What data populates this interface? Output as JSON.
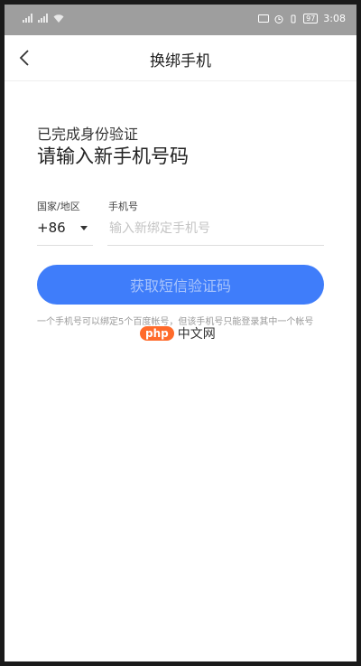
{
  "status_bar": {
    "time": "3:08",
    "battery": "97"
  },
  "header": {
    "title": "换绑手机"
  },
  "main": {
    "verified_text": "已完成身份验证",
    "prompt_text": "请输入新手机号码",
    "country_label": "国家/地区",
    "country_code": "+86",
    "phone_label": "手机号",
    "phone_placeholder": "输入新绑定手机号",
    "phone_value": "",
    "submit_label": "获取短信验证码",
    "note": "一个手机号可以绑定5个百度帐号，但该手机号只能登录其中一个帐号"
  },
  "watermark": {
    "pill": "php",
    "text": "中文网"
  },
  "colors": {
    "primary": "#3f7dfa",
    "status_bar": "#9e9e9e",
    "watermark": "#ff6b2b"
  }
}
